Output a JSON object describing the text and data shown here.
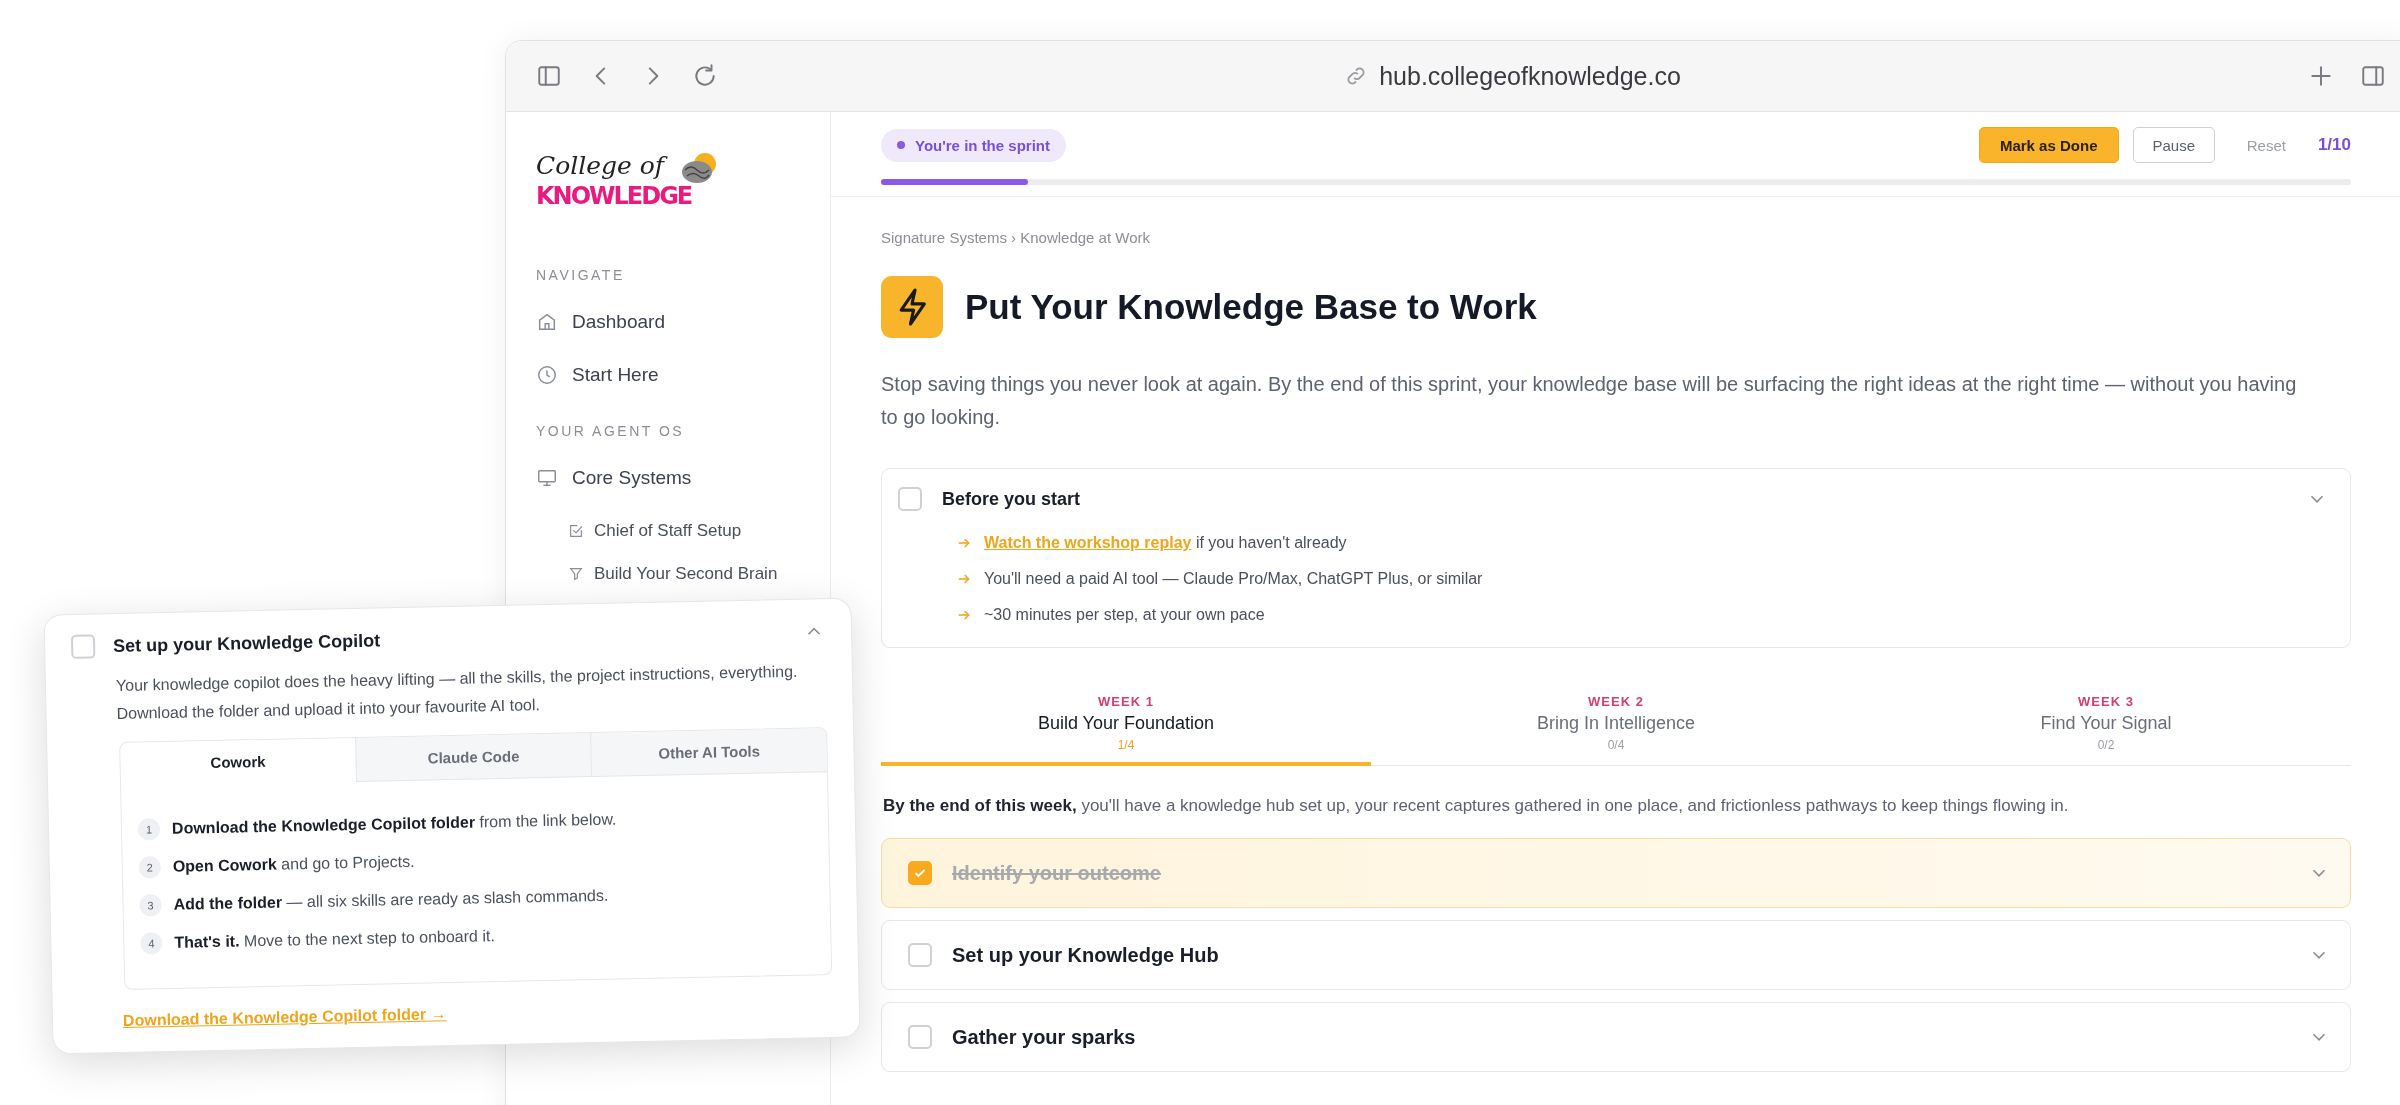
{
  "browser": {
    "url": "hub.collegeofknowledge.co"
  },
  "sidebar": {
    "logo": {
      "script": "College of",
      "wordmark": "KNOWLEDGE"
    },
    "sections": [
      {
        "heading": "NAVIGATE",
        "items": [
          {
            "label": "Dashboard"
          },
          {
            "label": "Start Here"
          }
        ]
      },
      {
        "heading": "YOUR AGENT OS",
        "items": [
          {
            "label": "Core Systems",
            "children": [
              {
                "label": "Chief of Staff Setup"
              },
              {
                "label": "Build Your Second Brain"
              }
            ]
          }
        ]
      }
    ]
  },
  "status": {
    "badge": "You're in the sprint",
    "buttons": [
      {
        "label": "Mark as Done",
        "kind": "primary"
      },
      {
        "label": "Pause",
        "kind": "outline"
      },
      {
        "label": "Reset",
        "kind": "plain"
      }
    ],
    "counter": "1/10",
    "progress": {
      "level": 0.1
    }
  },
  "lesson": {
    "breadcrumb": "Signature Systems › Knowledge at Work",
    "title": "Put Your Knowledge Base to Work",
    "description": "Stop saving things you never look at again. By the end of this sprint, your knowledge base will be surfacing the right ideas at the right time — without you having to go looking.",
    "before": {
      "title": "Before you start",
      "checked": false,
      "bullets": [
        {
          "link": "Watch the workshop replay",
          "text": "if you haven't already"
        },
        {
          "text": "You'll need a paid AI tool — Claude Pro/Max, ChatGPT Plus, or similar"
        },
        {
          "text": "~30 minutes per step, at your own pace"
        }
      ]
    },
    "weeks": [
      {
        "label": "WEEK 1",
        "title": "Build Your Foundation",
        "count": "1/4",
        "selected": true
      },
      {
        "label": "WEEK 2",
        "title": "Bring In Intelligence",
        "count": "0/4",
        "selected": false
      },
      {
        "label": "WEEK 3",
        "title": "Find Your Signal",
        "count": "0/2",
        "selected": false
      }
    ],
    "week_summary": "**By the end of this week,** you'll have a knowledge hub set up, your recent captures gathered in one place, and frictionless pathways to keep things flowing in.",
    "steps": [
      {
        "title": "Identify your outcome",
        "checked": true
      },
      {
        "title": "Set up your Knowledge Hub",
        "checked": false
      },
      {
        "title": "Gather your sparks",
        "checked": false
      }
    ]
  },
  "popup": {
    "title": "Set up your Knowledge Copilot",
    "checked": false,
    "description": "Your knowledge copilot does the heavy lifting — all the skills, the project instructions, everything. Download the folder and upload it into your favourite AI tool.",
    "tabs": [
      {
        "label": "Cowork",
        "selected": true
      },
      {
        "label": "Claude Code",
        "selected": false
      },
      {
        "label": "Other AI Tools",
        "selected": false
      }
    ],
    "steps": [
      {
        "number": "1",
        "text": "**Download the Knowledge Copilot folder** from the link below."
      },
      {
        "number": "2",
        "text": "**Open Cowork** and go to Projects."
      },
      {
        "number": "3",
        "text": "**Add the folder** — all six skills are ready as slash commands."
      },
      {
        "number": "4",
        "text": "**That's it.** Move to the next step to onboard it."
      }
    ],
    "link": "Download the Knowledge Copilot folder →"
  }
}
